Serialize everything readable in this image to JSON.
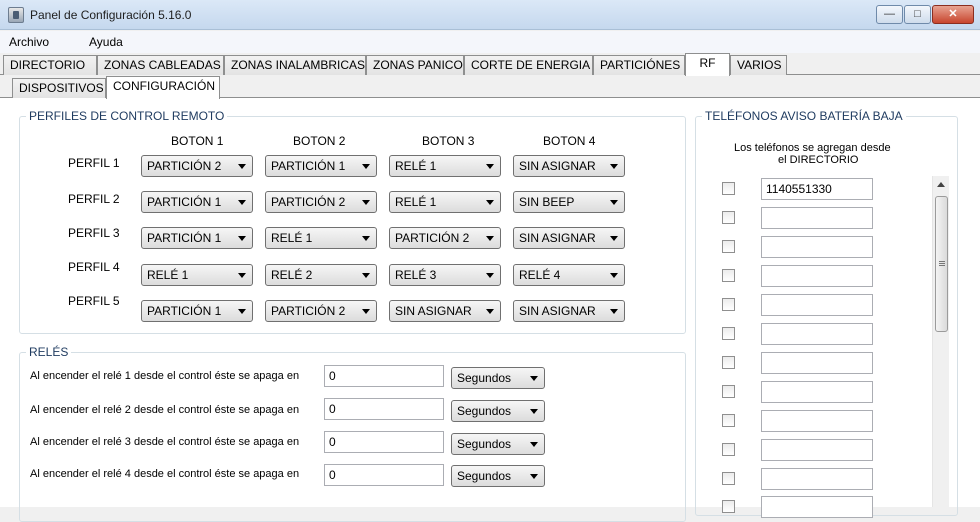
{
  "window": {
    "title": "Panel de Configuración 5.16.0"
  },
  "menu": [
    "Archivo",
    "Ayuda"
  ],
  "main_tabs": [
    "DIRECTORIO",
    "ZONAS CABLEADAS",
    "ZONAS INALAMBRICAS",
    "ZONAS PANICO",
    "CORTE DE ENERGIA",
    "PARTICIÓNES",
    "RF",
    "VARIOS"
  ],
  "active_main_tab": "RF",
  "sub_tabs": [
    "DISPOSITIVOS",
    "CONFIGURACIÓN"
  ],
  "active_sub_tab": "CONFIGURACIÓN",
  "perfiles": {
    "title": "PERFILES DE CONTROL REMOTO",
    "headers": [
      "BOTON 1",
      "BOTON 2",
      "BOTON 3",
      "BOTON 4"
    ],
    "rows": [
      {
        "label": "PERFIL 1",
        "values": [
          "PARTICIÓN 2",
          "PARTICIÓN 1",
          "RELÉ 1",
          "SIN ASIGNAR"
        ]
      },
      {
        "label": "PERFIL 2",
        "values": [
          "PARTICIÓN 1",
          "PARTICIÓN 2",
          "RELÉ 1",
          "SIN BEEP"
        ]
      },
      {
        "label": "PERFIL 3",
        "values": [
          "PARTICIÓN 1",
          "RELÉ 1",
          "PARTICIÓN 2",
          "SIN ASIGNAR"
        ]
      },
      {
        "label": "PERFIL 4",
        "values": [
          "RELÉ 1",
          "RELÉ 2",
          "RELÉ 3",
          "RELÉ 4"
        ]
      },
      {
        "label": "PERFIL 5",
        "values": [
          "PARTICIÓN 1",
          "PARTICIÓN 2",
          "SIN ASIGNAR",
          "SIN ASIGNAR"
        ]
      }
    ]
  },
  "reles": {
    "title": "RELÉS",
    "rows": [
      {
        "label": "Al encender el relé 1 desde el control éste se apaga en",
        "value": "0",
        "unit": "Segundos"
      },
      {
        "label": "Al encender el relé 2 desde el control éste se apaga en",
        "value": "0",
        "unit": "Segundos"
      },
      {
        "label": "Al encender el relé 3 desde el control éste se apaga en",
        "value": "0",
        "unit": "Segundos"
      },
      {
        "label": "Al encender el relé 4 desde el control éste se apaga en",
        "value": "0",
        "unit": "Segundos"
      }
    ]
  },
  "telefonos": {
    "title": "TELÉFONOS AVISO BATERÍA BAJA",
    "note_line1": "Los teléfonos se agregan desde",
    "note_line2": "el DIRECTORIO",
    "entries": [
      "1140551330",
      "",
      "",
      "",
      "",
      "",
      "",
      "",
      "",
      "",
      "",
      ""
    ]
  }
}
